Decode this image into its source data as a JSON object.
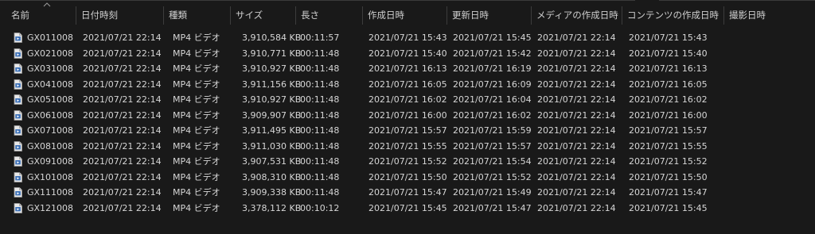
{
  "columns": {
    "name": "名前",
    "date": "日付時刻",
    "type": "種類",
    "size": "サイズ",
    "length": "長さ",
    "created": "作成日時",
    "modified": "更新日時",
    "media_created": "メディアの作成日時",
    "content_created": "コンテンツの作成日時",
    "shot_date": "撮影日時"
  },
  "sort": {
    "column": "name",
    "icon": "chevron-up-icon"
  },
  "file_icon": "video-file-icon",
  "files": [
    {
      "name": "GX011008",
      "date": "2021/07/21 22:14",
      "type": "MP4 ビデオ",
      "size": "3,910,584 KB",
      "length": "00:11:57",
      "created": "2021/07/21 15:43",
      "modified": "2021/07/21 15:45",
      "media_created": "2021/07/21 22:14",
      "content_created": "2021/07/21 15:43"
    },
    {
      "name": "GX021008",
      "date": "2021/07/21 22:14",
      "type": "MP4 ビデオ",
      "size": "3,910,771 KB",
      "length": "00:11:48",
      "created": "2021/07/21 15:40",
      "modified": "2021/07/21 15:42",
      "media_created": "2021/07/21 22:14",
      "content_created": "2021/07/21 15:40"
    },
    {
      "name": "GX031008",
      "date": "2021/07/21 22:14",
      "type": "MP4 ビデオ",
      "size": "3,910,927 KB",
      "length": "00:11:48",
      "created": "2021/07/21 16:13",
      "modified": "2021/07/21 16:19",
      "media_created": "2021/07/21 22:14",
      "content_created": "2021/07/21 16:13"
    },
    {
      "name": "GX041008",
      "date": "2021/07/21 22:14",
      "type": "MP4 ビデオ",
      "size": "3,911,156 KB",
      "length": "00:11:48",
      "created": "2021/07/21 16:05",
      "modified": "2021/07/21 16:09",
      "media_created": "2021/07/21 22:14",
      "content_created": "2021/07/21 16:05"
    },
    {
      "name": "GX051008",
      "date": "2021/07/21 22:14",
      "type": "MP4 ビデオ",
      "size": "3,910,927 KB",
      "length": "00:11:48",
      "created": "2021/07/21 16:02",
      "modified": "2021/07/21 16:04",
      "media_created": "2021/07/21 22:14",
      "content_created": "2021/07/21 16:02"
    },
    {
      "name": "GX061008",
      "date": "2021/07/21 22:14",
      "type": "MP4 ビデオ",
      "size": "3,909,907 KB",
      "length": "00:11:48",
      "created": "2021/07/21 16:00",
      "modified": "2021/07/21 16:02",
      "media_created": "2021/07/21 22:14",
      "content_created": "2021/07/21 16:00"
    },
    {
      "name": "GX071008",
      "date": "2021/07/21 22:14",
      "type": "MP4 ビデオ",
      "size": "3,911,495 KB",
      "length": "00:11:48",
      "created": "2021/07/21 15:57",
      "modified": "2021/07/21 15:59",
      "media_created": "2021/07/21 22:14",
      "content_created": "2021/07/21 15:57"
    },
    {
      "name": "GX081008",
      "date": "2021/07/21 22:14",
      "type": "MP4 ビデオ",
      "size": "3,911,030 KB",
      "length": "00:11:48",
      "created": "2021/07/21 15:55",
      "modified": "2021/07/21 15:57",
      "media_created": "2021/07/21 22:14",
      "content_created": "2021/07/21 15:55"
    },
    {
      "name": "GX091008",
      "date": "2021/07/21 22:14",
      "type": "MP4 ビデオ",
      "size": "3,907,531 KB",
      "length": "00:11:48",
      "created": "2021/07/21 15:52",
      "modified": "2021/07/21 15:54",
      "media_created": "2021/07/21 22:14",
      "content_created": "2021/07/21 15:52"
    },
    {
      "name": "GX101008",
      "date": "2021/07/21 22:14",
      "type": "MP4 ビデオ",
      "size": "3,908,310 KB",
      "length": "00:11:48",
      "created": "2021/07/21 15:50",
      "modified": "2021/07/21 15:52",
      "media_created": "2021/07/21 22:14",
      "content_created": "2021/07/21 15:50"
    },
    {
      "name": "GX111008",
      "date": "2021/07/21 22:14",
      "type": "MP4 ビデオ",
      "size": "3,909,338 KB",
      "length": "00:11:48",
      "created": "2021/07/21 15:47",
      "modified": "2021/07/21 15:49",
      "media_created": "2021/07/21 22:14",
      "content_created": "2021/07/21 15:47"
    },
    {
      "name": "GX121008",
      "date": "2021/07/21 22:14",
      "type": "MP4 ビデオ",
      "size": "3,378,112 KB",
      "length": "00:10:12",
      "created": "2021/07/21 15:45",
      "modified": "2021/07/21 15:47",
      "media_created": "2021/07/21 22:14",
      "content_created": "2021/07/21 15:45"
    }
  ]
}
